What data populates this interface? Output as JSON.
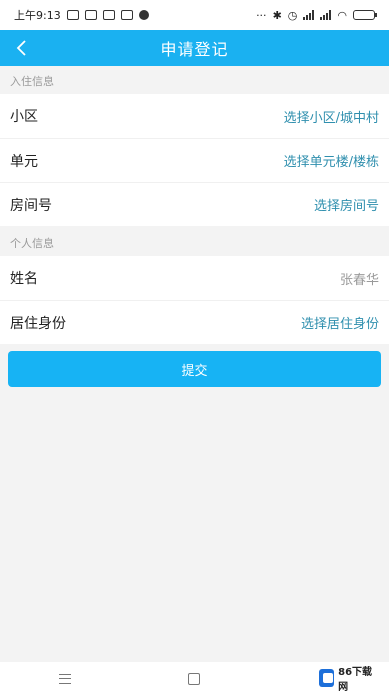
{
  "status_bar": {
    "time": "上午9:13"
  },
  "header": {
    "title": "申请登记"
  },
  "sections": {
    "residence_title": "入住信息",
    "personal_title": "个人信息"
  },
  "form": {
    "community_label": "小区",
    "community_value": "选择小区/城中村",
    "unit_label": "单元",
    "unit_value": "选择单元楼/楼栋",
    "room_label": "房间号",
    "room_value": "选择房间号",
    "name_label": "姓名",
    "name_value": "张春华",
    "identity_label": "居住身份",
    "identity_value": "选择居住身份"
  },
  "actions": {
    "submit_label": "提交"
  },
  "watermark": {
    "text": "86下载网"
  },
  "colors": {
    "primary": "#1ab1f1",
    "link": "#2f8fae",
    "background": "#f3f3f3"
  }
}
